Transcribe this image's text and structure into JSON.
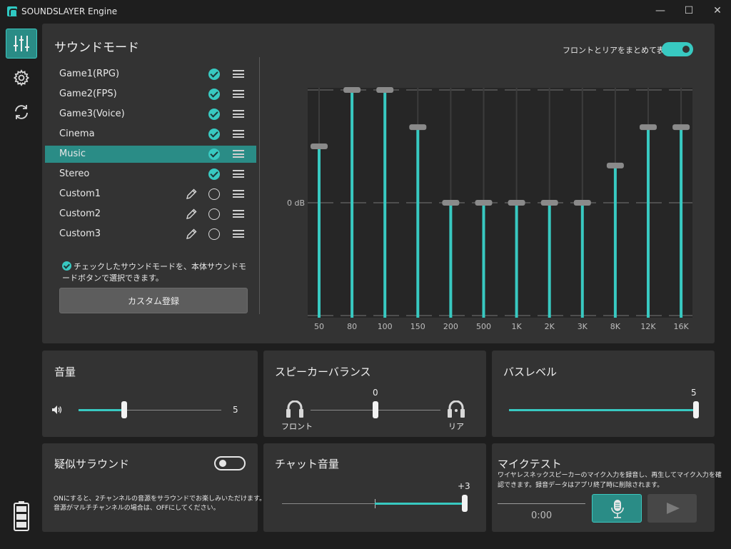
{
  "window": {
    "title": "SOUNDSLAYER Engine",
    "minimize": "—",
    "maximize": "☐",
    "close": "✕"
  },
  "sidebar": {
    "items": [
      "equalizer-icon",
      "settings-icon",
      "sync-icon"
    ],
    "battery": "battery-icon"
  },
  "sound_mode": {
    "title": "サウンドモード",
    "items": [
      {
        "label": "Game1(RPG)",
        "checked": true,
        "editable": false
      },
      {
        "label": "Game2(FPS)",
        "checked": true,
        "editable": false
      },
      {
        "label": "Game3(Voice)",
        "checked": true,
        "editable": false
      },
      {
        "label": "Cinema",
        "checked": true,
        "editable": false
      },
      {
        "label": "Music",
        "checked": true,
        "editable": false,
        "selected": true
      },
      {
        "label": "Stereo",
        "checked": true,
        "editable": false
      },
      {
        "label": "Custom1",
        "checked": false,
        "editable": true
      },
      {
        "label": "Custom2",
        "checked": false,
        "editable": true
      },
      {
        "label": "Custom3",
        "checked": false,
        "editable": true
      }
    ],
    "note": "チェックしたサウンドモードを、本体サウンドモードボタンで選択できます。",
    "custom_button": "カスタム登録",
    "toggle_label": "フロントとリアをまとめて表示",
    "toggle_on": true
  },
  "equalizer": {
    "zero_label": "0 dB",
    "bands": [
      "50",
      "80",
      "100",
      "150",
      "200",
      "500",
      "1K",
      "2K",
      "3K",
      "8K",
      "12K",
      "16K"
    ],
    "levels": [
      0.5,
      1,
      1,
      0.67,
      0,
      0,
      0,
      0,
      0,
      0.33,
      0.67,
      0.67
    ],
    "accent": "#38c9c1"
  },
  "volume": {
    "title": "音量",
    "value": "5",
    "level": 0.32
  },
  "speaker_balance": {
    "title": "スピーカーバランス",
    "value": "0",
    "front_label": "フロント",
    "rear_label": "リア",
    "level": 0.5
  },
  "bass_level": {
    "title": "バスレベル",
    "value": "5",
    "level": 1
  },
  "pseudo_surround": {
    "title": "疑似サラウンド",
    "enabled": false,
    "desc_line1": "ONにすると、2チャンネルの音源をサラウンドでお楽しみいただけます。",
    "desc_line2": "音源がマルチチャンネルの場合は、OFFにしてください。"
  },
  "chat_volume": {
    "title": "チャット音量",
    "value": "+3",
    "level": 1
  },
  "mic_test": {
    "title": "マイクテスト",
    "desc_line1": "ワイヤレスネックスピーカーのマイク入力を録音し、再生してマイク入力を確",
    "desc_line2": "認できます。録音データはアプリ終了時に削除されます。",
    "time": "0:00"
  }
}
